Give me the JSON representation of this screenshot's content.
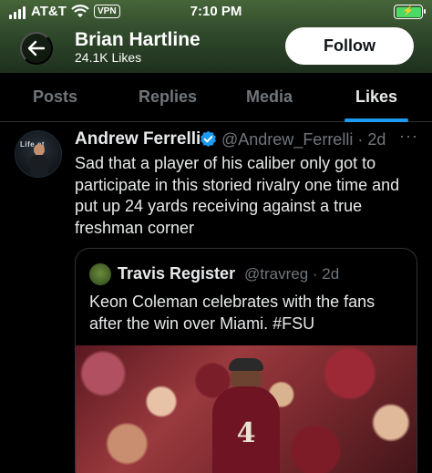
{
  "status_bar": {
    "carrier": "AT&T",
    "vpn": "VPN",
    "time": "7:10 PM",
    "battery_icon": "charging-battery-icon"
  },
  "profile": {
    "name": "Brian Hartline",
    "likes": "24.1K Likes",
    "follow_label": "Follow",
    "back_icon": "back-arrow-icon"
  },
  "tabs": [
    {
      "label": "Posts"
    },
    {
      "label": "Replies"
    },
    {
      "label": "Media"
    },
    {
      "label": "Likes"
    }
  ],
  "active_tab": "Likes",
  "tweet": {
    "author": "Andrew Ferrelli",
    "handle_time": "@Andrew_Ferrelli · 2d",
    "more": "···",
    "avatar_text": "Life  et",
    "text": "Sad that a player of his caliber only got to participate in this storied rivalry one time and put up 24 yards receiving against a true freshman corner",
    "quote": {
      "author": "Travis Register",
      "handle_time": "@travreg · 2d",
      "text": "Keon Coleman celebrates with the fans after the win over Miami. #FSU",
      "jersey_number": "4"
    }
  },
  "colors": {
    "accent": "#1d9bf0",
    "background": "#000000",
    "secondary_text": "#71767b"
  }
}
